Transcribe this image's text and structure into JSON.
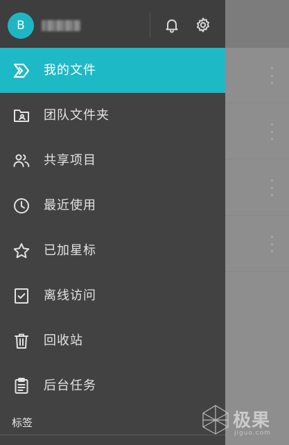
{
  "account": {
    "avatar_letter": "B",
    "name": ""
  },
  "header": {
    "notifications_icon": "bell-icon",
    "settings_icon": "gear-icon"
  },
  "nav": {
    "items": [
      {
        "label": "我的文件",
        "icon": "my-files-icon",
        "active": true
      },
      {
        "label": "团队文件夹",
        "icon": "team-folder-icon",
        "active": false
      },
      {
        "label": "共享项目",
        "icon": "shared-people-icon",
        "active": false
      },
      {
        "label": "最近使用",
        "icon": "clock-icon",
        "active": false
      },
      {
        "label": "已加星标",
        "icon": "star-icon",
        "active": false
      },
      {
        "label": "离线访问",
        "icon": "offline-checklist-icon",
        "active": false
      },
      {
        "label": "回收站",
        "icon": "trash-icon",
        "active": false
      },
      {
        "label": "后台任务",
        "icon": "clipboard-icon",
        "active": false
      }
    ]
  },
  "tags_heading": "标签",
  "background_toolbar": {
    "view_icon": "grid-view-icon",
    "more_icon": "more-vertical-icon"
  },
  "watermark": {
    "text": "极果",
    "subtext": "jiguo.com"
  },
  "colors": {
    "accent": "#1eb9c6",
    "drawer_background": "#424242",
    "text": "#e3e3e3",
    "scrim": "#8e8e8e"
  }
}
